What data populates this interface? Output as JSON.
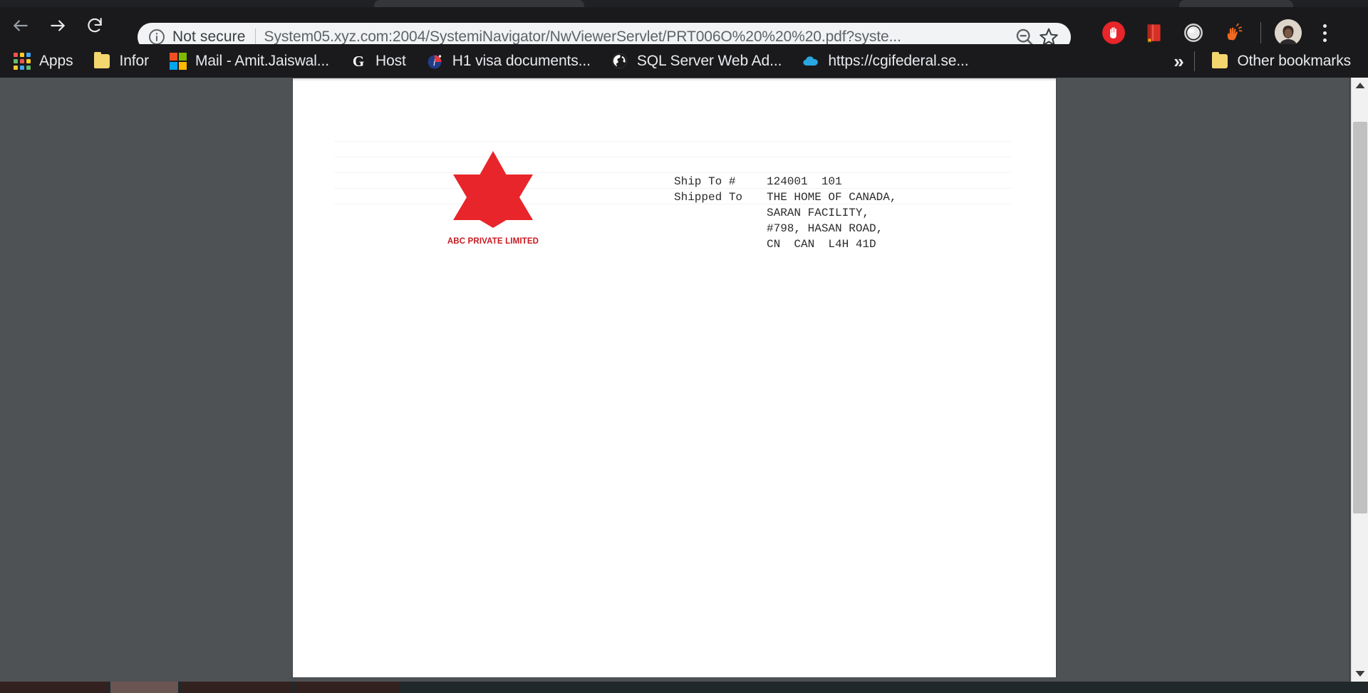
{
  "browser": {
    "nav": {
      "back_label": "Back",
      "forward_label": "Forward",
      "reload_label": "Reload"
    },
    "omnibox": {
      "security_label": "Not secure",
      "security_icon": "info-circle-icon",
      "url": "System05.xyz.com:2004/SystemiNavigator/NwViewerServlet/PRT006O%20%20%20.pdf?syste...",
      "zoom_out_icon": "zoom-out-magnifier-icon",
      "bookmark_icon": "star-outline-icon"
    },
    "extensions": [
      {
        "name": "adblock-extension-icon",
        "color": "#e8252a"
      },
      {
        "name": "reading-list-extension-icon",
        "color": "#d93025"
      },
      {
        "name": "grey-circle-extension-icon",
        "color": "#d8d8d8"
      },
      {
        "name": "honey-extension-icon",
        "color": "#f26a21"
      }
    ],
    "profile": {
      "name": "profile-avatar",
      "label": ""
    },
    "menu": {
      "name": "chrome-menu-icon",
      "label": ""
    }
  },
  "bookmarks": {
    "items": [
      {
        "label": "Apps",
        "icon": "apps-grid-icon"
      },
      {
        "label": "Infor",
        "icon": "folder-icon"
      },
      {
        "label": "Mail - Amit.Jaiswal...",
        "icon": "microsoft-outlook-icon"
      },
      {
        "label": "Host",
        "icon": "google-g-icon"
      },
      {
        "label": "H1 visa documents...",
        "icon": "info-blue-icon"
      },
      {
        "label": "SQL Server Web Ad...",
        "icon": "globe-icon"
      },
      {
        "label": "https://cgifederal.se...",
        "icon": "cloud-icon"
      }
    ],
    "overflow_label": "»",
    "other_bookmarks": {
      "label": "Other bookmarks",
      "icon": "folder-icon"
    }
  },
  "document": {
    "logo": {
      "shape": "six-pointed-star",
      "color": "#E8252A",
      "company_name": "ABC PRIVATE LIMITED"
    },
    "ship_to": {
      "rows": [
        {
          "label": "Ship To #",
          "value": "124001  101"
        },
        {
          "label": "Shipped To",
          "value": "THE HOME OF CANADA,"
        },
        {
          "label": "",
          "value": "SARAN FACILITY,"
        },
        {
          "label": "",
          "value": "#798, HASAN ROAD,"
        },
        {
          "label": "",
          "value": "CN  CAN  L4H 41D"
        }
      ]
    }
  },
  "scrollbar": {
    "up_arrow": "scroll-up-arrow-icon",
    "down_arrow": "scroll-down-arrow-icon",
    "thumb": "scrollbar-thumb"
  },
  "taskbar": {
    "clock": ""
  }
}
